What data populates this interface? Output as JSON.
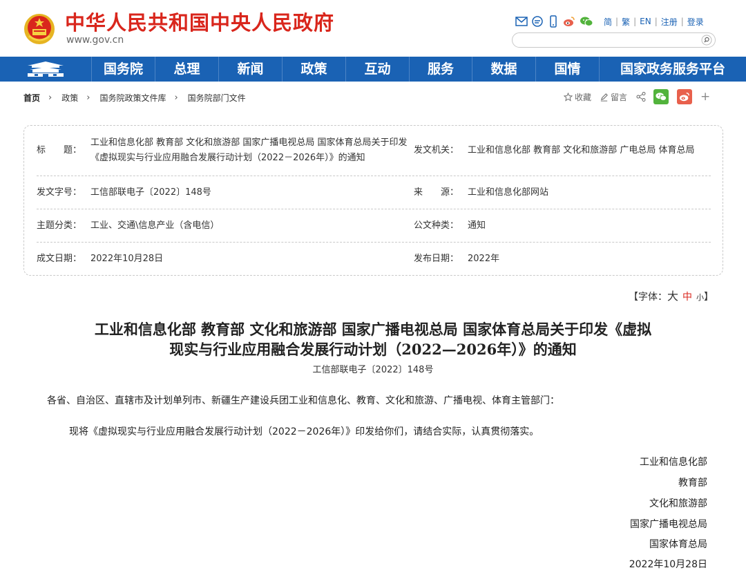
{
  "header": {
    "site_title": "中华人民共和国中央人民政府",
    "site_domain": "www.gov.cn",
    "icons": [
      "mail-icon",
      "chat-icon",
      "mobile-icon",
      "weibo-icon",
      "wechat-icon"
    ],
    "links": [
      "简",
      "繁",
      "EN",
      "注册",
      "登录"
    ],
    "search_placeholder": ""
  },
  "nav": {
    "items": [
      "国务院",
      "总理",
      "新闻",
      "政策",
      "互动",
      "服务",
      "数据",
      "国情",
      "国家政务服务平台"
    ]
  },
  "breadcrumb": {
    "items": [
      "首页",
      "政策",
      "国务院政策文件库",
      "国务院部门文件"
    ]
  },
  "share": {
    "favorite": "收藏",
    "comment": "留言",
    "plus": "+"
  },
  "meta": {
    "title_label": "标　　题：",
    "title_value": "工业和信息化部 教育部 文化和旅游部 国家广播电视总局 国家体育总局关于印发《虚拟现实与行业应用融合发展行动计划（2022－2026年）》的通知",
    "issuer_label": "发文机关：",
    "issuer_value": "工业和信息化部 教育部 文化和旅游部 广电总局 体育总局",
    "docno_label": "发文字号：",
    "docno_value": "工信部联电子〔2022〕148号",
    "source_label": "来　　源：",
    "source_value": "工业和信息化部网站",
    "subject_label": "主题分类：",
    "subject_value": "工业、交通\\信息产业（含电信）",
    "doctype_label": "公文种类：",
    "doctype_value": "通知",
    "written_label": "成文日期：",
    "written_value": "2022年10月28日",
    "published_label": "发布日期：",
    "published_value": "2022年"
  },
  "fontsize": {
    "prefix": "【字体：",
    "big": "大",
    "mid": "中",
    "small": "小",
    "suffix": "】"
  },
  "article": {
    "title_line1": "工业和信息化部 教育部 文化和旅游部 国家广播电视总局 国家体育总局关于印发《虚拟",
    "title_line2": "现实与行业应用融合发展行动计划（2022—2026年）》的通知",
    "doc_number": "工信部联电子〔2022〕148号",
    "addressee": "各省、自治区、直辖市及计划单列市、新疆生产建设兵团工业和信息化、教育、文化和旅游、广播电视、体育主管部门：",
    "body": "现将《虚拟现实与行业应用融合发展行动计划（2022－2026年）》印发给你们，请结合实际，认真贯彻落实。",
    "signatories": [
      "工业和信息化部",
      "教育部",
      "文化和旅游部",
      "国家广播电视总局",
      "国家体育总局"
    ],
    "date": "2022年10月28日"
  },
  "colors": {
    "brand_red": "#d9261c",
    "nav_blue": "#1a62b4",
    "wechat_green": "#52b33c",
    "weibo_red": "#e8604c"
  }
}
